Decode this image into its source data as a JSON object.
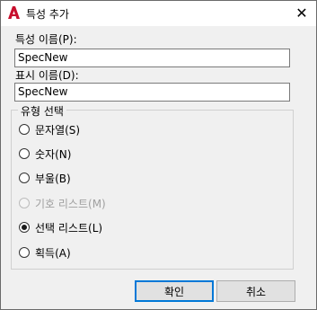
{
  "window": {
    "title": "특성 추가",
    "close_glyph": "✕",
    "app_icon": "autocad-a-icon",
    "accent": "#c8102e"
  },
  "form": {
    "property_name_label": "특성 이름(P):",
    "property_name_value": "SpecNew",
    "display_name_label": "표시 이름(D):",
    "display_name_value": "SpecNew"
  },
  "type_group": {
    "title": "유형 선택",
    "options": [
      {
        "label": "문자열(S)",
        "checked": false,
        "disabled": false
      },
      {
        "label": "숫자(N)",
        "checked": false,
        "disabled": false
      },
      {
        "label": "부울(B)",
        "checked": false,
        "disabled": false
      },
      {
        "label": "기호 리스트(M)",
        "checked": false,
        "disabled": true
      },
      {
        "label": "선택 리스트(L)",
        "checked": true,
        "disabled": false
      },
      {
        "label": "획득(A)",
        "checked": false,
        "disabled": false
      }
    ]
  },
  "buttons": {
    "ok_label": "확인",
    "cancel_label": "취소",
    "default_border_color": "#0078d7"
  }
}
